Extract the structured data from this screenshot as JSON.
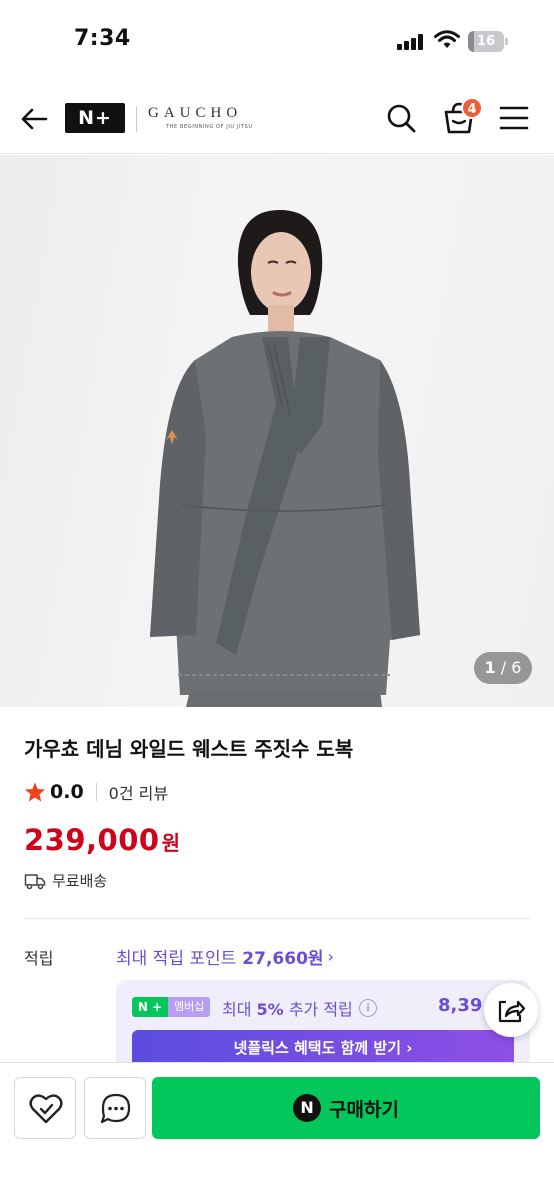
{
  "status_bar": {
    "time": "7:34",
    "battery_level": "16",
    "battery_fraction": 0.16
  },
  "header": {
    "brand_mark": "N+",
    "brand_name": "GAUCHO",
    "brand_tagline": "THE BEGINNING OF JIU JITSU",
    "cart_count": "4",
    "icons": [
      "back-arrow-icon",
      "search-icon",
      "cart-icon",
      "menu-icon"
    ]
  },
  "gallery": {
    "current": "1",
    "separator": "/",
    "total": "6"
  },
  "product": {
    "title": "가우쵸 데님 와일드 웨스트 주짓수 도복",
    "rating": "0.0",
    "review_count": "0건 리뷰",
    "price": "239,000",
    "price_unit": "원",
    "shipping": "무료배송"
  },
  "points": {
    "label": "적립",
    "max_text": "최대 적립 포인트",
    "max_amount": "27,660원",
    "chevron": "›"
  },
  "promo": {
    "np_badge": "N +",
    "membership": "멤버십",
    "text_prefix": "최대",
    "percent": "5%",
    "text_suffix": "추가 적립",
    "amount": "8,39",
    "netflix_button": "넷플릭스 혜택도 함께 받기 ›"
  },
  "bottom_bar": {
    "buy_icon": "N",
    "buy_label": "구매하기"
  },
  "colors": {
    "price": "#d0021b",
    "accent_purple": "#6b4fd0",
    "buy_green": "#03c75a",
    "cart_badge": "#f25a33",
    "star": "#f0421e"
  }
}
